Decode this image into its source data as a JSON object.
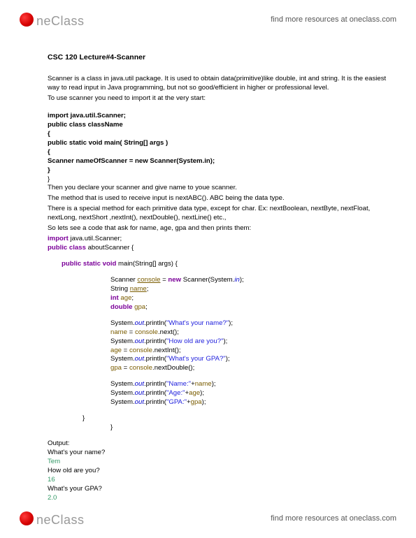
{
  "brand": {
    "part1": "ne",
    "part2": "Class"
  },
  "find_link": "find more resources at oneclass.com",
  "title": "CSC 120 Lecture#4-Scanner",
  "intro": {
    "p1": "Scanner is a class in java.util package. It is used to obtain data(primitive)like double, int and string. It is the easiest way to read input in Java programming, but not so good/efficient in higher or professional level.",
    "p2": "To use scanner you need to import it at the very start:"
  },
  "snippet1": {
    "l1a": "import",
    "l1b": " java.util.Scanner;",
    "l2a": " public class",
    "l2b": " className",
    "l3": "{",
    "l4a": " public static void",
    "l4b": " main( String[] args )",
    "l5": "         {",
    "l6a": "Scanner nameOfScanner = ",
    "l6b": "new",
    "l6c": " Scanner(System.in);",
    "l7": "           }",
    "l8": "}"
  },
  "explain": {
    "p1": "Then you declare your scanner and give name to youe scanner.",
    "p2": "The method that is used to receive input is nextABC(). ABC being the data type.",
    "p3": "There is a special method for each primitive data type, except for char. Ex: nextBoolean, nextByte, nextFloat, nextLong, nextShort ,nextInt(), nextDouble(), nextLine() etc.,",
    "p4": " So lets see a code that ask for name, age, gpa and then prints them:"
  },
  "snippet2": {
    "import_kw": "import",
    "import_rest": " java.util.Scanner;",
    "pc_kw": "public class",
    "pc_name": " aboutScanner {",
    "main_kw": "public static void",
    "main_rest": " main(String[] args) {",
    "sc_a": "Scanner ",
    "sc_b": "console",
    "sc_c": " = ",
    "sc_new": "new",
    "sc_d": " Scanner(System.",
    "sc_in": "in",
    "sc_e": ");",
    "str_a": "String ",
    "str_b": "name",
    "str_c": ";",
    "int_a": "int",
    "int_b": " age",
    "int_c": ";",
    "dbl_a": "double",
    "dbl_b": " gpa",
    "dbl_c": ";",
    "p1a": "System.",
    "p1b": "out",
    "p1c": ".println(",
    "p1d": "\"What's your name?\"",
    "p1e": ");",
    "r1a": "name",
    "r1b": " = ",
    "r1c": "console",
    "r1d": ".next();",
    "p2a": "System.",
    "p2b": "out",
    "p2c": ".println(",
    "p2d": "\"How old are you?\"",
    "p2e": ");",
    "r2a": "age",
    "r2b": " = ",
    "r2c": "console",
    "r2d": ".nextInt();",
    "p3a": "System.",
    "p3b": "out",
    "p3c": ".println(",
    "p3d": "\"What's your GPA?\"",
    "p3e": ");",
    "r3a": "gpa",
    "r3b": " = ",
    "r3c": "console",
    "r3d": ".nextDouble();",
    "o1a": "System.",
    "o1b": "out",
    "o1c": ".println(",
    "o1d": "\"Name:\"",
    "o1e": "+",
    "o1f": "name",
    "o1g": ");",
    "o2a": "System.",
    "o2b": "out",
    "o2c": ".println(",
    "o2d": "\"Age:\"",
    "o2e": "+",
    "o2f": "age",
    "o2g": ");",
    "o3a": "System.",
    "o3b": "out",
    "o3c": ".println(",
    "o3d": "\"GPA:\"",
    "o3e": "+",
    "o3f": "gpa",
    "o3g": ");",
    "close1": "}",
    "close2": "}"
  },
  "output": {
    "label": "Output:",
    "q1": "What's your name?",
    "a1": "Tem",
    "q2": "How old are you?",
    "a2": "16",
    "q3": "What's your GPA?",
    "a3": "2.0"
  }
}
